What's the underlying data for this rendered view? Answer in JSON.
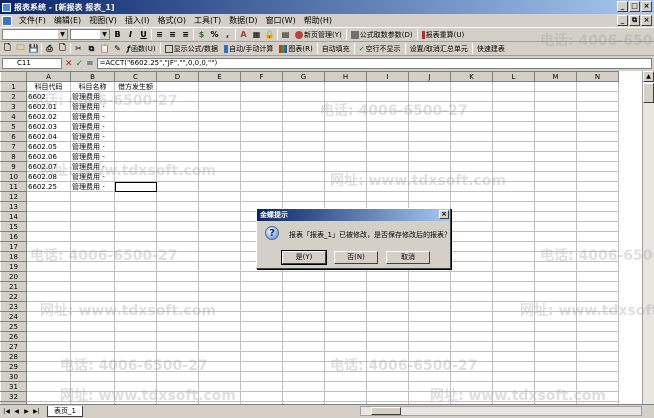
{
  "window": {
    "title": "报表系统 - [新报表 报表_1]",
    "min_label": "_",
    "max_label": "□",
    "close_label": "×"
  },
  "menu": [
    "文件(F)",
    "编辑(E)",
    "视图(V)",
    "插入(I)",
    "格式(O)",
    "工具(T)",
    "数据(D)",
    "窗口(W)",
    "帮助(H)"
  ],
  "mdi": {
    "min_label": "_",
    "restore_label": "⧉",
    "close_label": "×"
  },
  "toolbar1": {
    "bold": "B",
    "italic": "I",
    "underline": "U",
    "percent": "%",
    "comma": ",",
    "page_manage": "新页管理(Y)",
    "formula_params": "公式取数参数(D)",
    "recalc": "报表重算(U)"
  },
  "toolbar2": {
    "function": "函数(U)",
    "show_formula": "显示公式/数据",
    "auto_calc": "自动/手动计算",
    "chart": "图表(R)",
    "auto_fill": "自动填充",
    "hide_empty_rows": "空行不显示",
    "set_summary": "设置/取消汇总单元",
    "quick_report": "快速建表"
  },
  "formula_bar": {
    "cell_ref": "C11",
    "formula": "=ACCT(\"6602.25\",\"JF\",\"\",0,0,0,\"\")"
  },
  "columns": [
    "A",
    "B",
    "C",
    "D",
    "E",
    "F",
    "G",
    "H",
    "I",
    "J",
    "K",
    "L",
    "M",
    "N"
  ],
  "rows": [
    [
      "科目代码",
      "科目名称",
      "借方发生额"
    ],
    [
      "6602",
      "管理费用",
      ""
    ],
    [
      "6602.01",
      "管理费用 -",
      ""
    ],
    [
      "6602.02",
      "管理费用 -",
      ""
    ],
    [
      "6602.03",
      "管理费用 -",
      ""
    ],
    [
      "6602.04",
      "管理费用 -",
      ""
    ],
    [
      "6602.05",
      "管理费用 -",
      ""
    ],
    [
      "6602.06",
      "管理费用 -",
      ""
    ],
    [
      "6602.07",
      "管理费用 -",
      ""
    ],
    [
      "6602.08",
      "管理费用 -",
      ""
    ],
    [
      "6602.25",
      "管理费用 -",
      ""
    ]
  ],
  "total_rows": 33,
  "selected_cell": {
    "row": 11,
    "col": "C"
  },
  "sheet_tabs": [
    "表页_1"
  ],
  "dialog": {
    "title": "金蝶提示",
    "message": "报表「报表_1」已被修改，是否保存修改后的报表？",
    "buttons": [
      "是(Y)",
      "否(N)",
      "取消"
    ],
    "close_label": "×",
    "icon": "question-icon"
  },
  "watermarks": [
    "电话: 4006-6500-27",
    "网址: www.tdxsoft.com"
  ]
}
